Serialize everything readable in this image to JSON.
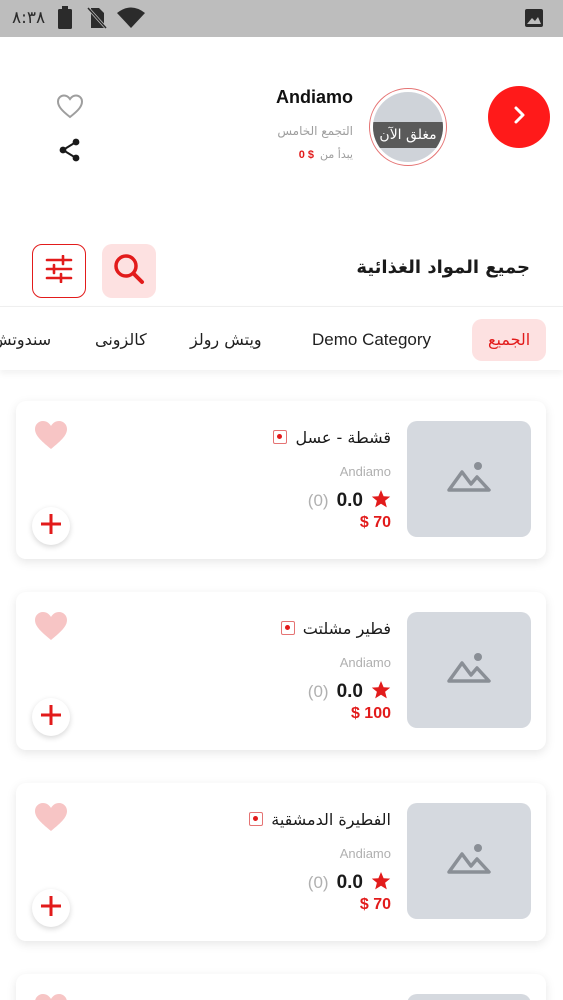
{
  "status_bar": {
    "time": "٨:٣٨",
    "icons": [
      "battery-icon",
      "no-sim-icon",
      "wifi-icon",
      "image-icon"
    ]
  },
  "restaurant": {
    "name": "Andiamo",
    "area": "التجمع الخامس",
    "starts_from_label": "يبدأ من",
    "starts_from_price": "$ 0",
    "closed_label": "مغلق الآن",
    "icons": [
      "chevron-right-icon",
      "heart-outline-icon",
      "share-icon"
    ]
  },
  "section": {
    "title": "جميع المواد الغذائية",
    "icons": [
      "search-icon",
      "filter-icon"
    ]
  },
  "tabs": [
    {
      "label": "الجميع",
      "active": true
    },
    {
      "label": "Demo Category",
      "active": false
    },
    {
      "label": "ويتش رولز",
      "active": false
    },
    {
      "label": "كالزونى",
      "active": false
    },
    {
      "label": "سندوتش",
      "active": false
    }
  ],
  "products": [
    {
      "name": "قشطة - عسل",
      "brand": "Andiamo",
      "rating": "0.0",
      "rating_count": "(0)",
      "price": "$ 70"
    },
    {
      "name": "فطير مشلتت",
      "brand": "Andiamo",
      "rating": "0.0",
      "rating_count": "(0)",
      "price": "$ 100"
    },
    {
      "name": "الفطيرة الدمشقية",
      "brand": "Andiamo",
      "rating": "0.0",
      "rating_count": "(0)",
      "price": "$ 70"
    }
  ],
  "colors": {
    "accent": "#e21b1b",
    "accent_light": "#fde1e1",
    "placeholder": "#d5d9df",
    "status_bar": "#bdbdbd"
  }
}
